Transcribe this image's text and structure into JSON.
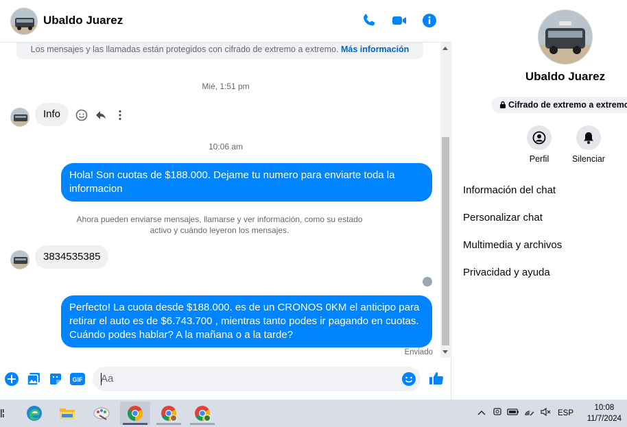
{
  "header": {
    "contact_name": "Ubaldo Juarez",
    "icons": [
      "phone-icon",
      "video-icon",
      "info-icon"
    ]
  },
  "colors": {
    "accent": "#0084ff",
    "bubble_in": "#f0f0f0",
    "muted": "#65676b"
  },
  "encryption_notice": {
    "text": "Los mensajes y las llamadas están protegidos con cifrado de extremo a extremo.",
    "link": "Más información"
  },
  "messages": {
    "ts1": "Mié, 1:51 pm",
    "in1": "Info",
    "ts2": "10:06 am",
    "out1": "Hola! Son cuotas de $188.000. Dejame tu numero para enviarte toda la informacion",
    "system_line1": "Ahora pueden enviarse mensajes, llamarse y ver información, como su estado",
    "system_line2": "activo y cuándo leyeron los mensajes.",
    "in2": "3834535385",
    "out2": "Perfecto! La cuota desde $188.000. es de un CRONOS 0KM el anticipo para retirar el auto es de $6.743.700 , mientras tanto podes ir pagando en cuotas. Cuándo podes hablar? A la mañana o a la tarde?",
    "status": "Enviado"
  },
  "composer": {
    "placeholder": "Aa"
  },
  "info_panel": {
    "name": "Ubaldo Juarez",
    "encryption": "Cifrado de extremo a extremo",
    "actions": {
      "profile": "Perfil",
      "mute": "Silenciar"
    },
    "menu": [
      "Información del chat",
      "Personalizar chat",
      "Multimedia y archivos",
      "Privacidad y ayuda"
    ]
  },
  "taskbar": {
    "time": "10:08",
    "date": "11/7/2024",
    "language": "ESP"
  }
}
